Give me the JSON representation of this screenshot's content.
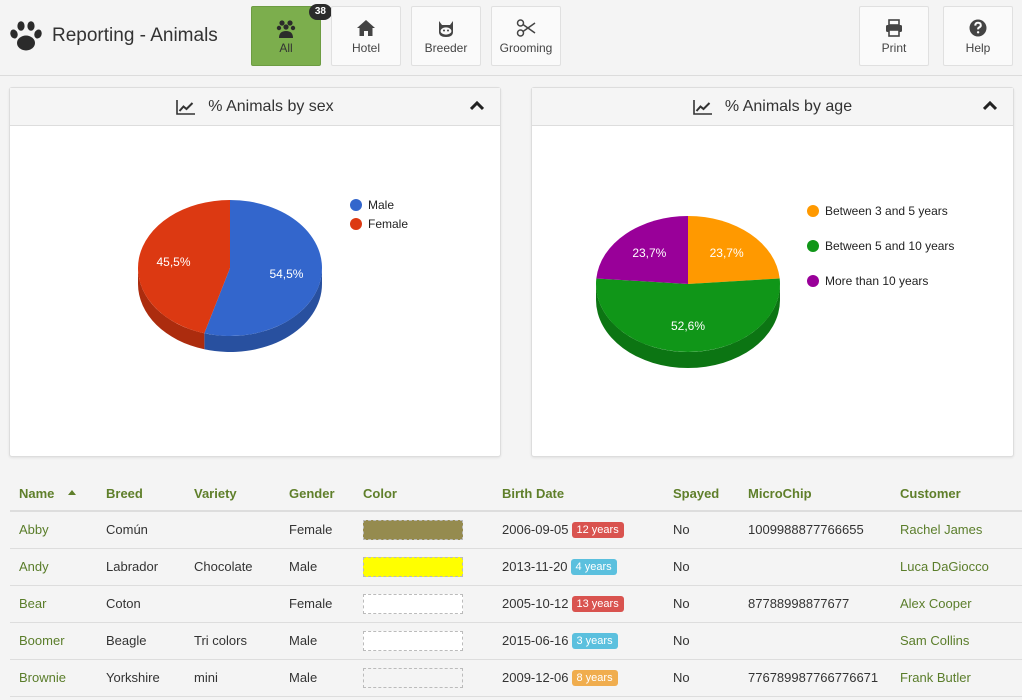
{
  "app": {
    "title": "Reporting - Animals",
    "logo_icon": "paw-icon"
  },
  "nav": {
    "buttons": [
      {
        "label": "All",
        "icon": "paw-group-icon",
        "active": true,
        "badge": "38"
      },
      {
        "label": "Hotel",
        "icon": "home-icon",
        "active": false
      },
      {
        "label": "Breeder",
        "icon": "cat-icon",
        "active": false
      },
      {
        "label": "Grooming",
        "icon": "scissors-icon",
        "active": false
      }
    ],
    "right_buttons": [
      {
        "label": "Print",
        "icon": "print-icon"
      },
      {
        "label": "Help",
        "icon": "question-circle-icon"
      }
    ]
  },
  "colors": {
    "accent_green": "#7cae4d",
    "link_green": "#5a7d2a",
    "badge_red": "#d9534f",
    "badge_blue": "#5bc0de",
    "badge_orange": "#f0ad4e"
  },
  "panels": [
    {
      "title": "% Animals by sex",
      "icon": "line-chart-icon",
      "collapse_icon": "chevron-up-icon"
    },
    {
      "title": "% Animals by age",
      "icon": "line-chart-icon",
      "collapse_icon": "chevron-up-icon"
    }
  ],
  "chart_data": [
    {
      "type": "pie",
      "title": "% Animals by sex",
      "categories": [
        "Male",
        "Female"
      ],
      "values": [
        54.5,
        45.5
      ],
      "labels": [
        "54,5%",
        "45,5%"
      ],
      "colors": [
        "#3366cc",
        "#dc3912"
      ],
      "legend": "right"
    },
    {
      "type": "pie",
      "title": "% Animals by age",
      "categories": [
        "Between 3 and 5 years",
        "Between 5 and 10 years",
        "More than 10 years"
      ],
      "values": [
        23.7,
        52.6,
        23.7
      ],
      "labels": [
        "23,7%",
        "52,6%",
        "23,7%"
      ],
      "colors": [
        "#ff9900",
        "#109618",
        "#990099"
      ],
      "legend": "right"
    }
  ],
  "table": {
    "columns": [
      "Name",
      "Breed",
      "Variety",
      "Gender",
      "Color",
      "Birth Date",
      "Spayed",
      "MicroChip",
      "Customer"
    ],
    "sorted_column": "Name",
    "rows": [
      {
        "name": "Abby",
        "breed": "Común",
        "variety": "",
        "gender": "Female",
        "color": "#958b4f",
        "birth_date": "2006-09-05",
        "age": "12 years",
        "age_color": "#d9534f",
        "spayed": "No",
        "microchip": "1009988877766655",
        "customer": "Rachel James"
      },
      {
        "name": "Andy",
        "breed": "Labrador",
        "variety": "Chocolate",
        "gender": "Male",
        "color": "#ffff00",
        "birth_date": "2013-11-20",
        "age": "4 years",
        "age_color": "#5bc0de",
        "spayed": "No",
        "microchip": "",
        "customer": "Luca DaGiocco"
      },
      {
        "name": "Bear",
        "breed": "Coton",
        "variety": "",
        "gender": "Female",
        "color": "#ffffff",
        "birth_date": "2005-10-12",
        "age": "13 years",
        "age_color": "#d9534f",
        "spayed": "No",
        "microchip": "87788998877677",
        "customer": "Alex Cooper"
      },
      {
        "name": "Boomer",
        "breed": "Beagle",
        "variety": "Tri colors",
        "gender": "Male",
        "color": "#ffffff",
        "birth_date": "2015-06-16",
        "age": "3 years",
        "age_color": "#5bc0de",
        "spayed": "No",
        "microchip": "",
        "customer": "Sam Collins"
      },
      {
        "name": "Brownie",
        "breed": "Yorkshire",
        "variety": "mini",
        "gender": "Male",
        "color": "#f4f4f4",
        "birth_date": "2009-12-06",
        "age": "8 years",
        "age_color": "#f0ad4e",
        "spayed": "No",
        "microchip": "776789987766776671",
        "customer": "Frank Butler"
      }
    ]
  }
}
